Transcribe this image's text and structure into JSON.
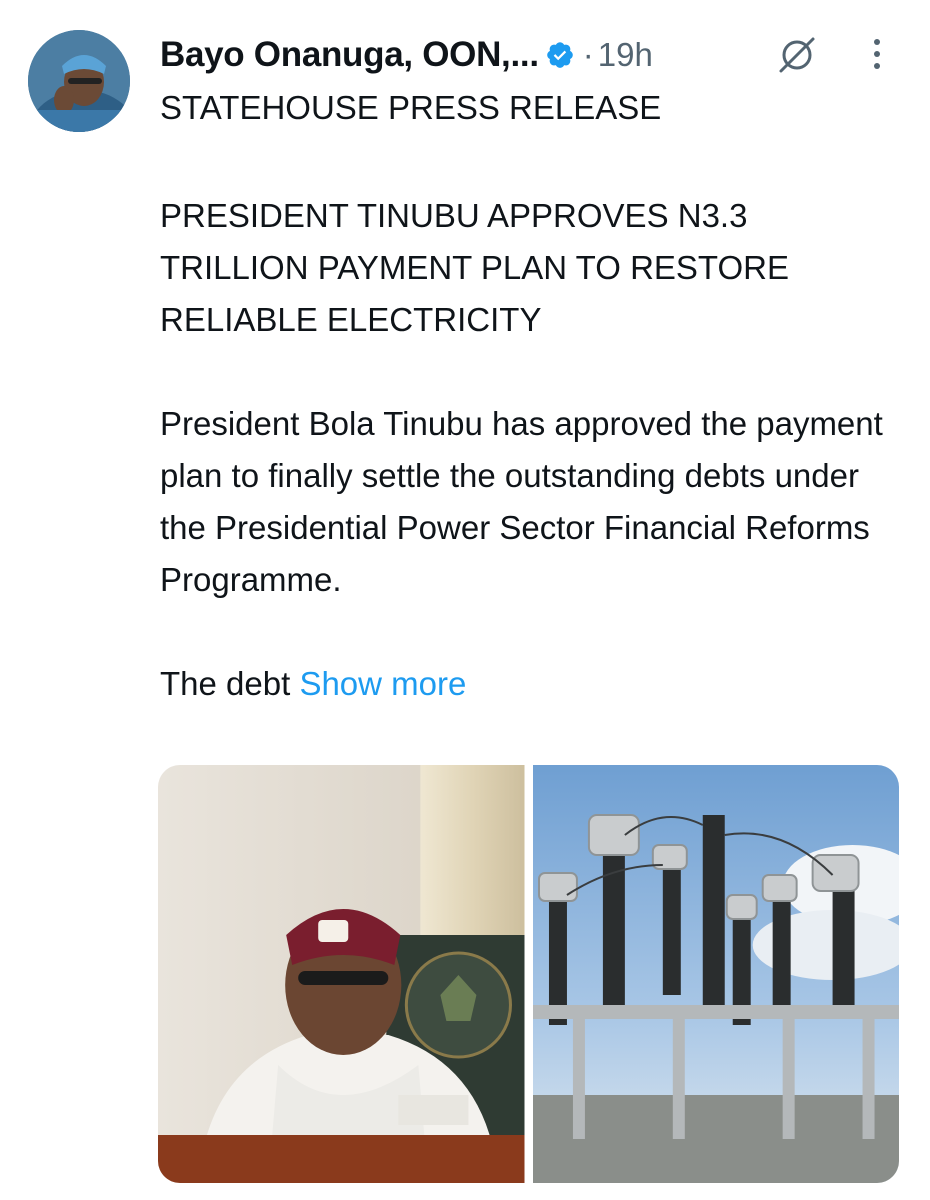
{
  "author": {
    "name": "Bayo Onanuga, OON,...",
    "verified_icon": "verified-badge-icon",
    "timestamp": "19h"
  },
  "icons": {
    "grok": "grok-icon",
    "more": "more-options-icon"
  },
  "tweet": {
    "lead": "STATEHOUSE PRESS RELEASE",
    "headline": "PRESIDENT TINUBU APPROVES N3.3 TRILLION PAYMENT PLAN TO RESTORE RELIABLE ELECTRICITY",
    "body": "President Bola Tinubu has approved the payment plan to finally settle the outstanding debts under the Presidential Power Sector Financial Reforms Programme.",
    "truncated": "The debt",
    "show_more": "Show more"
  },
  "media": [
    {
      "subject": "president-photo"
    },
    {
      "subject": "electrical-substation-photo"
    }
  ],
  "colors": {
    "link": "#1d9bf0",
    "secondary_text": "#536471",
    "verified": "#1d9bf0"
  }
}
